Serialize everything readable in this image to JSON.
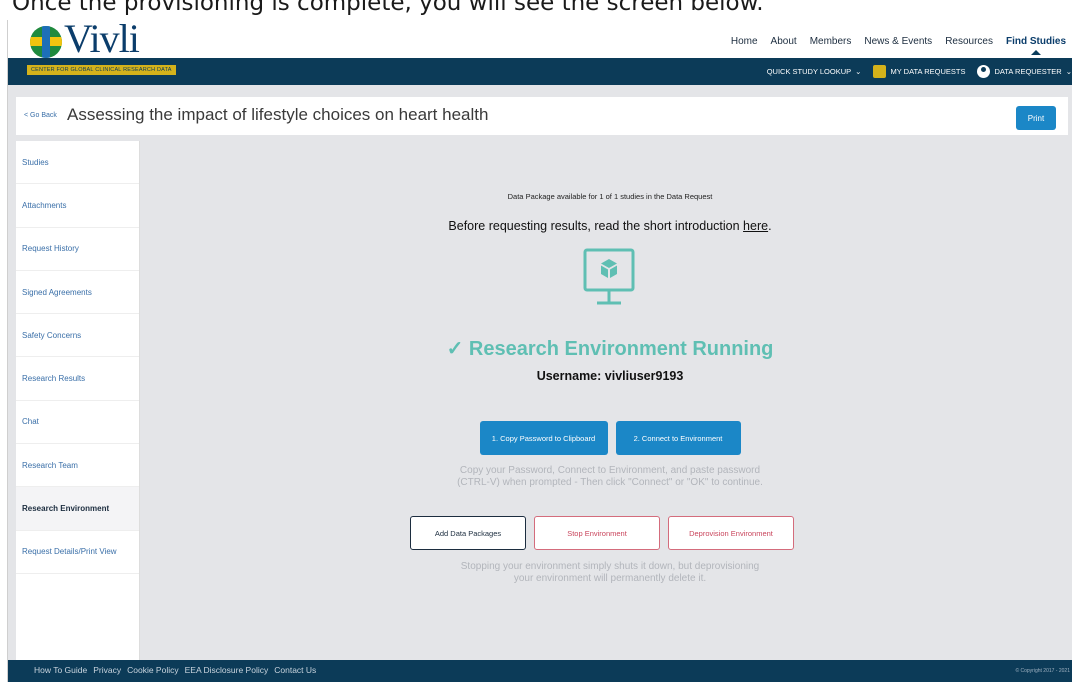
{
  "caption": "Once the provisioning is complete, you will see the screen below.",
  "header": {
    "logo_text": "Vivli",
    "tagline": "CENTER FOR GLOBAL CLINICAL RESEARCH DATA",
    "nav": [
      "Home",
      "About",
      "Members",
      "News & Events",
      "Resources",
      "Find Studies"
    ],
    "subnav": {
      "quick_lookup": "QUICK STUDY LOOKUP",
      "my_requests": "MY DATA REQUESTS",
      "user": "DATA REQUESTER"
    }
  },
  "titlebar": {
    "go_back": "< Go Back",
    "title": "Assessing the impact of lifestyle choices on heart health",
    "print": "Print"
  },
  "sidebar": {
    "items": [
      {
        "label": "Studies"
      },
      {
        "label": "Attachments"
      },
      {
        "label": "Request History"
      },
      {
        "label": "Signed Agreements"
      },
      {
        "label": "Safety Concerns"
      },
      {
        "label": "Research Results"
      },
      {
        "label": "Chat"
      },
      {
        "label": "Research Team"
      },
      {
        "label": "Research Environment"
      },
      {
        "label": "Request Details/Print View"
      }
    ],
    "active_index": 8
  },
  "main": {
    "available": "Data Package available for 1 of 1 studies in the Data Request",
    "intro_prefix": "Before requesting results, read the short introduction ",
    "intro_link": "here",
    "intro_suffix": ".",
    "status": "✓ Research Environment Running",
    "username": "Username: vivliuser9193",
    "copy_button": "1. Copy Password to Clipboard",
    "connect_button": "2. Connect to Environment",
    "hint_line1": "Copy your Password, Connect to Environment, and paste password",
    "hint_line2": "(CTRL-V) when prompted - Then click \"Connect\" or \"OK\" to continue.",
    "add_button": "Add Data Packages",
    "stop_button": "Stop Environment",
    "deprovision_button": "Deprovision Environment",
    "stop_hint_line1": "Stopping your environment simply shuts it down, but deprovisioning",
    "stop_hint_line2": "your environment will permanently delete it."
  },
  "footer": {
    "links": [
      "How To Guide",
      "Privacy",
      "Cookie Policy",
      "EEA Disclosure Policy",
      "Contact Us"
    ],
    "copyright": "© Copyright 2017 - 2021"
  },
  "colors": {
    "navy": "#0c3b58",
    "accent_blue": "#1b87c7",
    "teal": "#5fbfb3",
    "danger": "#c9455c",
    "gold": "#d4b21b"
  }
}
